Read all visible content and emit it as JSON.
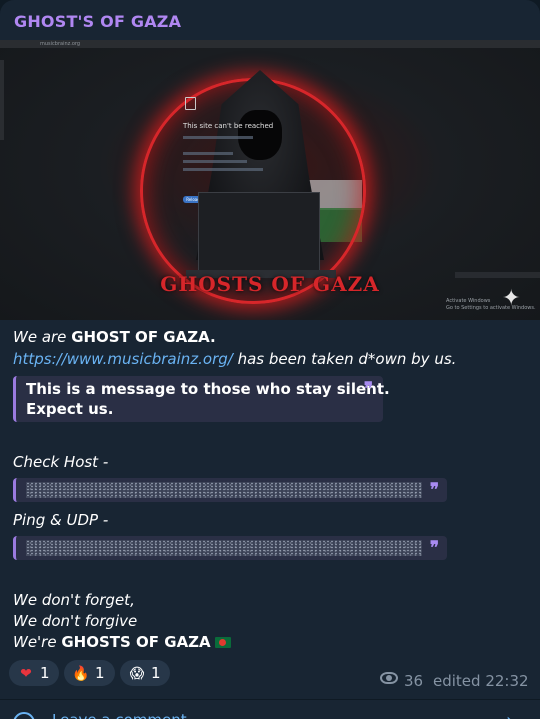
{
  "channel": {
    "name": "GHOST'S OF GAZA"
  },
  "image": {
    "url_text": "musicbrainz.org",
    "page_title": "This site can't be reached",
    "button": "Reload",
    "logo_text": "GHOSTS OF GAZA",
    "watermark_line1": "Activate Windows",
    "watermark_line2": "Go to Settings to activate Windows."
  },
  "message": {
    "line1_prefix": "We are ",
    "line1_bold": "GHOST OF GAZA.",
    "link": "https://www.musicbrainz.org/",
    "line2_suffix": " has been taken d*own by us.",
    "quote_line1": "This is a message to those who stay silent.",
    "quote_line2": "Expect us.",
    "check_host_label": "Check Host -",
    "ping_label": "Ping & UDP -",
    "closing_line1": "We don't forget,",
    "closing_line2": "We don't forgive",
    "closing_line3_prefix": "We're ",
    "closing_line3_bold": "GHOSTS OF GAZA"
  },
  "reactions": [
    {
      "emoji": "❤",
      "count": "1",
      "icon": "heart-icon"
    },
    {
      "emoji": "🔥",
      "count": "1",
      "icon": "fire-icon"
    },
    {
      "emoji": "😱",
      "count": "1",
      "icon": "scream-icon"
    }
  ],
  "meta": {
    "views": "36",
    "edited": "edited 22:32"
  },
  "footer": {
    "comment_label": "Leave a comment"
  },
  "colors": {
    "accent": "#b087f2",
    "link": "#6ab3f3",
    "bubble": "#182533"
  }
}
